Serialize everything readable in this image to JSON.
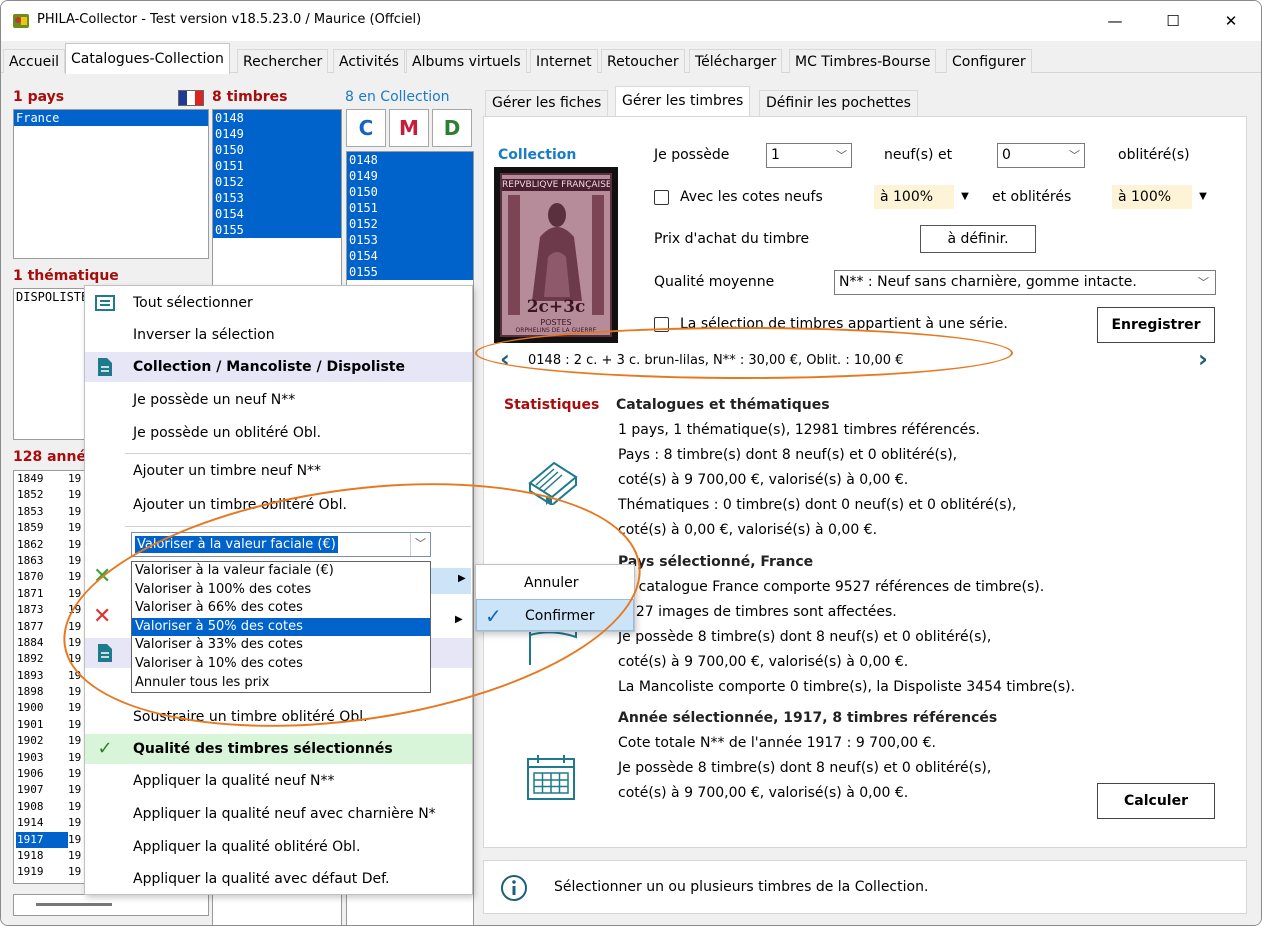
{
  "window": {
    "title": "PHILA-Collector - Test version v18.5.23.0 / Maurice (Offciel)",
    "minimize": "—",
    "maximize": "☐",
    "close": "✕"
  },
  "main_tabs": [
    "Accueil",
    "Catalogues-Collection",
    "Rechercher",
    "Activités",
    "Albums virtuels",
    "Internet",
    "Retoucher",
    "Télécharger",
    "MC Timbres-Bourse",
    "Configurer"
  ],
  "left": {
    "pays_label": "1 pays",
    "pays_items": [
      "France"
    ],
    "timbres_label": "8 timbres",
    "timbres_items": [
      "0148",
      "0149",
      "0150",
      "0151",
      "0152",
      "0153",
      "0154",
      "0155"
    ],
    "collection_label": "8 en Collection",
    "cmd_buttons": [
      "C",
      "M",
      "D"
    ],
    "collection_items": [
      "0148",
      "0149",
      "0150",
      "0151",
      "0152",
      "0153",
      "0154",
      "0155"
    ],
    "thematique_label": "1 thématique",
    "thematique_items": [
      "DISPOLISTE"
    ],
    "annees_label": "128 années",
    "annees_items": [
      "1849",
      "1852",
      "1853",
      "1859",
      "1862",
      "1863",
      "1870",
      "1871",
      "1873",
      "1877",
      "1884",
      "1892",
      "1893",
      "1898",
      "1900",
      "1901",
      "1902",
      "1903",
      "1906",
      "1907",
      "1908",
      "1914",
      "1917",
      "1918",
      "1919"
    ],
    "annees_col2": [
      "19",
      "19",
      "19",
      "19",
      "19",
      "19",
      "19",
      "19",
      "19",
      "19",
      "19",
      "19",
      "19",
      "19",
      "19",
      "19",
      "19",
      "19",
      "19",
      "19",
      "19",
      "19",
      "19",
      "19",
      "19"
    ],
    "selected_year": "1917"
  },
  "context_menu": {
    "items": {
      "select_all": "Tout sélectionner",
      "invert": "Inverser la sélection",
      "hdr_collection": "Collection / Mancoliste / Dispoliste",
      "own_new": "Je possède un neuf N**",
      "own_used": "Je possède un oblitéré Obl.",
      "add_new": "Ajouter un timbre neuf N**",
      "add_used": "Ajouter un timbre oblitéré Obl.",
      "subtract_used": "Soustraire un timbre oblitéré Obl.",
      "hdr_quality": "Qualité des timbres sélectionnés",
      "q_new": "Appliquer la qualité neuf N**",
      "q_hinged": "Appliquer la qualité neuf avec charnière N*",
      "q_used": "Appliquer la qualité oblitéré Obl.",
      "q_defect": "Appliquer la qualité avec défaut Def."
    },
    "combo_value": "Valoriser à la valeur faciale (€)",
    "dropdown_options": [
      "Valoriser à la valeur faciale (€)",
      "Valoriser à 100% des cotes",
      "Valoriser à 66% des cotes",
      "Valoriser à 50% des cotes",
      "Valoriser à 33% des cotes",
      "Valoriser à 10% des cotes",
      "Annuler tous les prix"
    ],
    "dropdown_selected": "Valoriser à 50% des cotes",
    "submenu": [
      "Annuler",
      "Confirmer"
    ]
  },
  "right": {
    "tabs": [
      "Gérer les fiches",
      "Gérer les timbres",
      "Définir les pochettes"
    ],
    "collection_title": "Collection",
    "je_possede": "Je possède",
    "qty_new": "1",
    "neufs_et": "neuf(s) et",
    "qty_used": "0",
    "oblitere": "oblitéré(s)",
    "avec_cotes": "Avec les cotes neufs",
    "pct_new": "à 100%",
    "et_obliteres": "et oblitérés",
    "pct_used": "à 100%",
    "prix_achat": "Prix d'achat du timbre",
    "a_definir": "à définir.",
    "qualite_moyenne": "Qualité moyenne",
    "qualite_value": "N** : Neuf sans charnière, gomme intacte.",
    "serie": "La sélection de timbres appartient à une série.",
    "enregistrer": "Enregistrer",
    "stamp_line": "0148 : 2 c. + 3 c. brun-lilas, N** : 30,00 €, Oblit. : 10,00 €",
    "stamp_top_text": "REPVBLIQVE FRANÇAISE",
    "stamp_value": "2c+3c",
    "stamp_bottom": "POSTES",
    "stamp_bottom2": "ORPHELINS DE LA GUERRE",
    "stats_title": "Statistiques",
    "cat_title": "Catalogues et thématiques",
    "cat_lines": [
      "1 pays, 1 thématique(s), 12981 timbres référencés.",
      "Pays : 8 timbre(s) dont 8 neuf(s) et 0 oblitéré(s),",
      "coté(s) à 9 700,00 €, valorisé(s) à 0,00 €.",
      "Thématiques : 0 timbre(s) dont 0 neuf(s) et 0 oblitéré(s),",
      "coté(s) à 0,00 €, valorisé(s) à 0,00 €."
    ],
    "pays_title": "Pays sélectionné, France",
    "pays_lines": [
      "Le catalogue France comporte 9527 références de timbre(s).",
      "9527 images de timbres sont affectées.",
      "Je possède 8 timbre(s) dont 8 neuf(s) et 0 oblitéré(s),",
      "coté(s) à 9 700,00 €, valorisé(s) à 0,00 €.",
      "La Mancoliste comporte 0 timbre(s), la Dispoliste 3454 timbre(s)."
    ],
    "annee_title": "Année sélectionnée, 1917, 8 timbres référencés",
    "annee_lines": [
      "Cote totale N** de l'année 1917 : 9 700,00 €.",
      "Je possède 8 timbre(s) dont 8 neuf(s) et 0 oblitéré(s),",
      "coté(s) à 9 700,00 €, valorisé(s) à 0,00 €."
    ],
    "calculer": "Calculer",
    "status": "Sélectionner un ou plusieurs timbres de la Collection."
  },
  "colors": {
    "accent_red": "#a80c0c",
    "accent_blue": "#1a7bc7",
    "selection": "#0063cc",
    "annotation": "#e8781e",
    "teal_icon": "#1f7a8c"
  }
}
